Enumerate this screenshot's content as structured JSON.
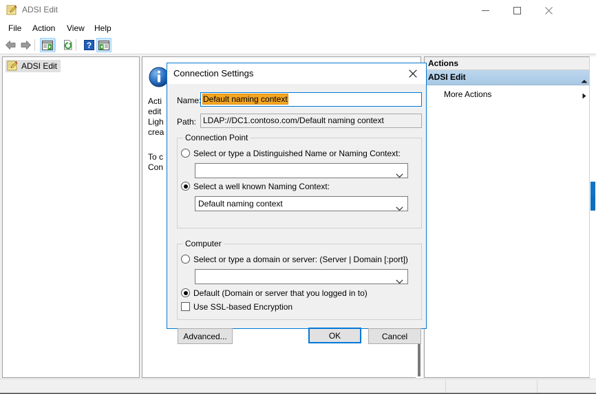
{
  "window": {
    "title": "ADSI Edit",
    "icon": "adsi-edit-icon",
    "minimize_label": "Minimize",
    "maximize_label": "Maximize",
    "close_label": "Close"
  },
  "menubar": {
    "items": [
      {
        "label": "File"
      },
      {
        "label": "Action"
      },
      {
        "label": "View"
      },
      {
        "label": "Help"
      }
    ]
  },
  "toolbar": {
    "buttons": [
      {
        "name": "back-icon",
        "label": "Back"
      },
      {
        "name": "forward-icon",
        "label": "Forward"
      },
      {
        "name": "show-hide-console-tree-icon",
        "label": "Show/Hide Console Tree"
      },
      {
        "name": "refresh-icon",
        "label": "Refresh"
      },
      {
        "name": "help-icon",
        "label": "Help"
      },
      {
        "name": "show-hide-action-pane-icon",
        "label": "Show/Hide Action Pane"
      }
    ]
  },
  "tree": {
    "root_label": "ADSI Edit",
    "root_icon": "adsi-edit-icon"
  },
  "main": {
    "info_icon": "information-icon",
    "description_visible": "Acti\nedit\nLigh\ncrea",
    "instruction_visible": "To c\nCon"
  },
  "actions": {
    "header": "Actions",
    "group_label": "ADSI Edit",
    "collapse_icon": "chevron-up-icon",
    "items": [
      {
        "label": "More Actions",
        "submenu_icon": "triangle-right-icon"
      }
    ]
  },
  "dialog": {
    "title": "Connection Settings",
    "close_icon": "close-icon",
    "name_label": "Name:",
    "name_value": "Default naming context",
    "name_selected": true,
    "path_label": "Path:",
    "path_value": "LDAP://DC1.contoso.com/Default naming context",
    "connection_point": {
      "title": "Connection Point",
      "radio_dn_label": "Select or type a Distinguished Name or Naming Context:",
      "radio_dn_selected": false,
      "dn_combo_value": "",
      "radio_wellknown_label": "Select a well known Naming Context:",
      "radio_wellknown_selected": true,
      "wellknown_combo_value": "Default naming context",
      "chevron_icon": "chevron-down-icon"
    },
    "computer": {
      "title": "Computer",
      "radio_server_label": "Select or type a domain or server: (Server | Domain [:port])",
      "radio_server_selected": false,
      "server_combo_value": "",
      "radio_default_label": "Default (Domain or server that you logged in to)",
      "radio_default_selected": true,
      "ssl_checkbox_label": "Use SSL-based Encryption",
      "ssl_checked": false,
      "chevron_icon": "chevron-down-icon"
    },
    "buttons": {
      "advanced": "Advanced...",
      "ok": "OK",
      "cancel": "Cancel"
    }
  },
  "statusbar": {
    "text": ""
  },
  "colors": {
    "accent": "#0078d7",
    "selection_highlight": "#f5a623",
    "actions_group_bg": "#bdd7ee",
    "toolbar_checked": "#cce8ff"
  }
}
